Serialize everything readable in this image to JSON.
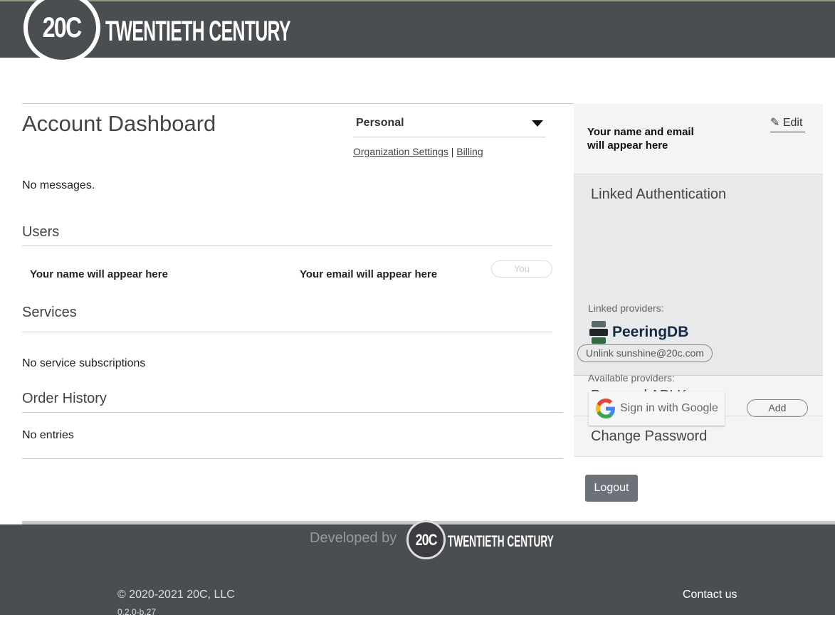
{
  "header": {
    "logo_mark": "20C",
    "logo_text": "TWENTIETH CENTURY"
  },
  "main": {
    "title": "Account Dashboard",
    "org_select": {
      "value": "Personal"
    },
    "links": {
      "org_settings": "Organization Settings",
      "separator": "|",
      "billing": "Billing"
    },
    "messages": "No messages.",
    "users": {
      "heading": "Users",
      "name": "Your name will appear here",
      "email": "Your email will appear here",
      "badge": "You"
    },
    "services": {
      "heading": "Services",
      "empty": "No service subscriptions"
    },
    "orders": {
      "heading": "Order History",
      "empty": "No entries"
    }
  },
  "sidebar": {
    "profile": {
      "line1": "Your name and email",
      "line2": "will appear here",
      "edit": "Edit"
    },
    "linked": {
      "title": "Linked Authentication",
      "linked_label": "Linked providers:",
      "provider": "PeeringDB",
      "unlink": "Unlink sunshine@20c.com",
      "available_label": "Available providers:",
      "google": "Sign in with Google",
      "add": "Add"
    },
    "api_keys": "Personal API Keys",
    "change_password": "Change Password",
    "logout": "Logout"
  },
  "footer": {
    "developed_by": "Developed by",
    "logo_mark": "20C",
    "logo_text": "TWENTIETH CENTURY",
    "copyright": "© 2020-2021 20C, LLC",
    "version": "0.2.0-b.27",
    "contact": "Contact us"
  }
}
